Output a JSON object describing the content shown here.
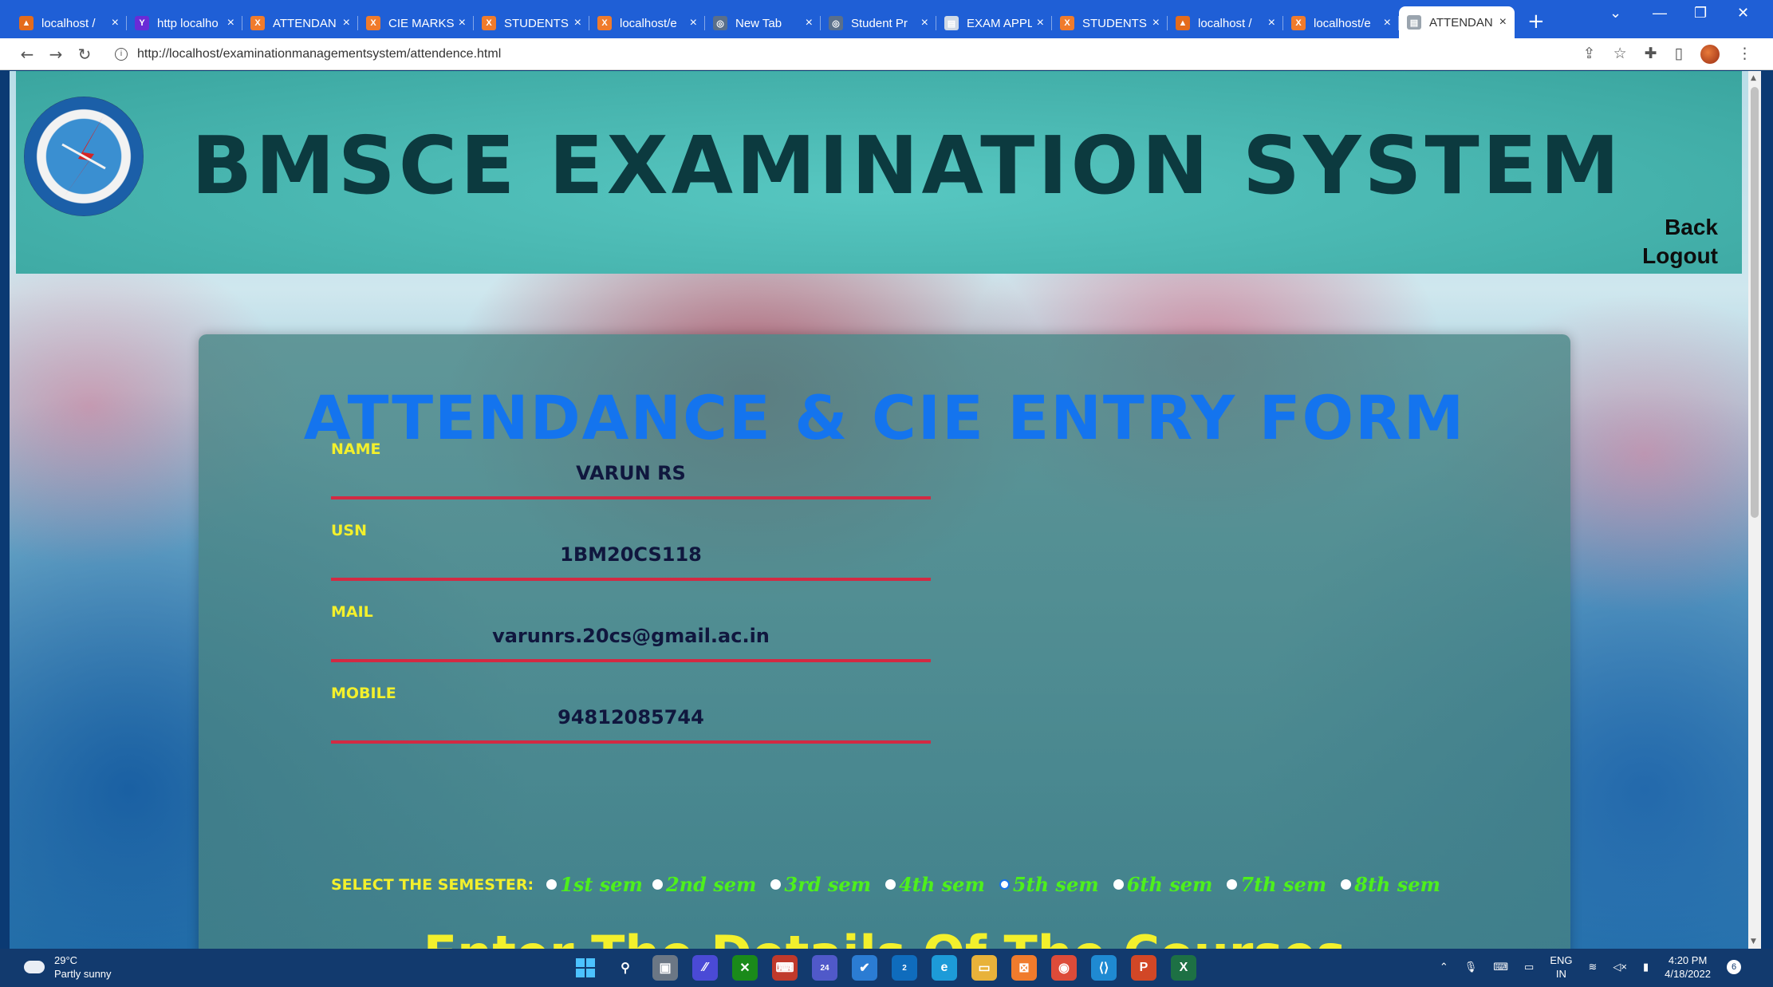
{
  "browser": {
    "tabs": [
      {
        "title": "localhost /",
        "fav_color": "#e46b1c",
        "fav_glyph": "▲"
      },
      {
        "title": "http localho",
        "fav_color": "#6a2bd6",
        "fav_glyph": "Y"
      },
      {
        "title": "ATTENDAN",
        "fav_color": "#f07b2c",
        "fav_glyph": "X"
      },
      {
        "title": "CIE MARKS",
        "fav_color": "#f07b2c",
        "fav_glyph": "X"
      },
      {
        "title": "STUDENTS",
        "fav_color": "#f07b2c",
        "fav_glyph": "X"
      },
      {
        "title": "localhost/e",
        "fav_color": "#f07b2c",
        "fav_glyph": "X"
      },
      {
        "title": "New Tab",
        "fav_color": "#5a6f8a",
        "fav_glyph": "◎"
      },
      {
        "title": "Student Pr",
        "fav_color": "#5a6f8a",
        "fav_glyph": "◎"
      },
      {
        "title": "EXAM APPL",
        "fav_color": "#cfd9e6",
        "fav_glyph": "▤"
      },
      {
        "title": "STUDENTS",
        "fav_color": "#f07b2c",
        "fav_glyph": "X"
      },
      {
        "title": "localhost /",
        "fav_color": "#e46b1c",
        "fav_glyph": "▲"
      },
      {
        "title": "localhost/e",
        "fav_color": "#f07b2c",
        "fav_glyph": "X"
      },
      {
        "title": "ATTENDAN",
        "fav_color": "#9aa4ae",
        "fav_glyph": "▤",
        "active": true
      }
    ],
    "url": "http://localhost/examinationmanagementsystem/attendence.html"
  },
  "header": {
    "title": "BMSCE EXAMINATION SYSTEM",
    "back_label": "Back",
    "logout_label": "Logout"
  },
  "form": {
    "title": "ATTENDANCE & CIE ENTRY FORM",
    "fields": [
      {
        "label": "NAME",
        "value": "VARUN RS"
      },
      {
        "label": "USN",
        "value": "1BM20CS118"
      },
      {
        "label": "MAIL",
        "value": "varunrs.20cs@gmail.ac.in"
      },
      {
        "label": "MOBILE",
        "value": "94812085744"
      }
    ],
    "semester_label": "SELECT THE SEMESTER:",
    "semesters": [
      "1st sem",
      "2nd sem",
      "3rd sem",
      "4th sem",
      "5th sem",
      "6th sem",
      "7th sem",
      "8th sem"
    ],
    "selected_semester": "5th sem",
    "subtitle": "Enter The Details Of The Courses"
  },
  "taskbar": {
    "temperature": "29°C",
    "weather": "Partly sunny",
    "language": "ENG",
    "region": "IN",
    "time": "4:20 PM",
    "date": "4/18/2022",
    "notification_count": "6",
    "teams_badge": "24",
    "mail_badge": "2"
  }
}
